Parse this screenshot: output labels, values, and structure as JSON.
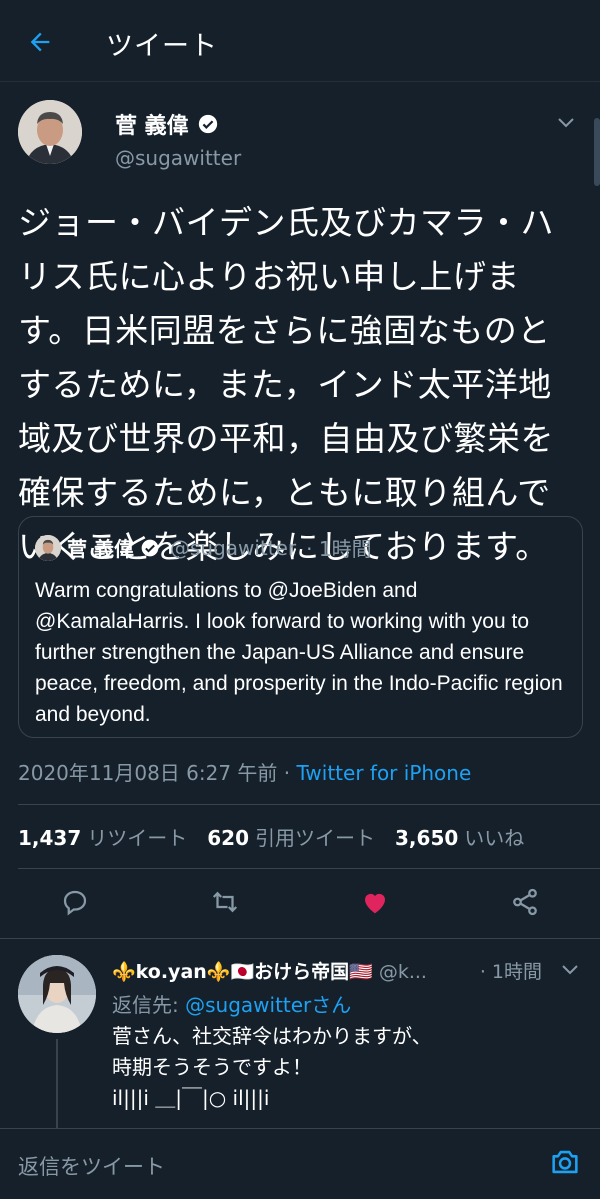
{
  "header": {
    "title": "ツイート"
  },
  "tweet": {
    "author_name": "菅 義偉",
    "author_handle": "@sugawitter",
    "text": "ジョー・バイデン氏及びカマラ・ハリス氏に心よりお祝い申し上げます。日米同盟をさらに強固なものとするために，また，インド太平洋地域及び世界の平和，自由及び繁栄を確保するために，ともに取り組んでいくことを楽しみにしております。",
    "quote": {
      "author_name": "菅 義偉",
      "author_handle": "@sugawitter",
      "time": "· 1時間",
      "text": "Warm congratulations to @JoeBiden and @KamalaHarris. I look forward to working with you to further strengthen the Japan-US Alliance and ensure peace, freedom, and prosperity in the Indo-Pacific region and beyond."
    },
    "timestamp": "2020年11月08日 6:27 午前",
    "separator": "·",
    "source": "Twitter for iPhone",
    "stats": {
      "retweets": "1,437",
      "retweets_label": "リツイート",
      "quotes": "620",
      "quotes_label": "引用ツイート",
      "likes": "3,650",
      "likes_label": "いいね"
    },
    "liked": true
  },
  "reply": {
    "author_name": "⚜️ko.yan⚜️🇯🇵おけら帝国🇺🇸",
    "author_handle": "@k...",
    "time": "· 1時間",
    "reply_to_label": "返信先: ",
    "reply_to_handle": "@sugawitter",
    "reply_to_suffix": "さん",
    "text": "菅さん、社交辞令はわかりますが、\n時期そうそうですよ！\nil|||i ＿|￣|○ il|||i"
  },
  "compose": {
    "placeholder": "返信をツイート"
  },
  "colors": {
    "background": "#15202b",
    "accent": "#1da1f2",
    "like": "#e0245e",
    "muted": "#8899a6"
  }
}
